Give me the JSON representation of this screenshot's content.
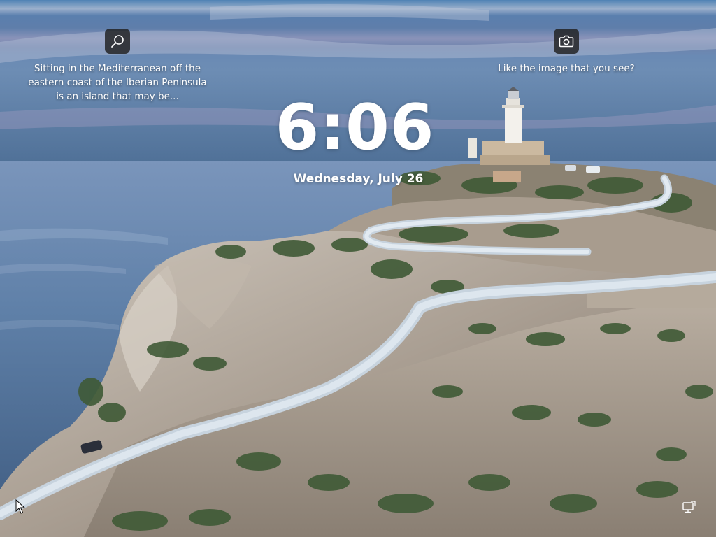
{
  "lockscreen": {
    "spotlight_info": {
      "text": "Sitting in the Mediterranean off the\neastern coast of the Iberian Peninsula\nis an island that may be...",
      "icon": "search-icon"
    },
    "like_image": {
      "text": "Like the image that you see?",
      "icon": "camera-icon"
    },
    "time": "6:06",
    "date": "Wednesday, July 26",
    "status_icons": [
      "network-icon"
    ]
  },
  "colors": {
    "text": "#ffffff",
    "widget_button_bg": "#202020"
  }
}
